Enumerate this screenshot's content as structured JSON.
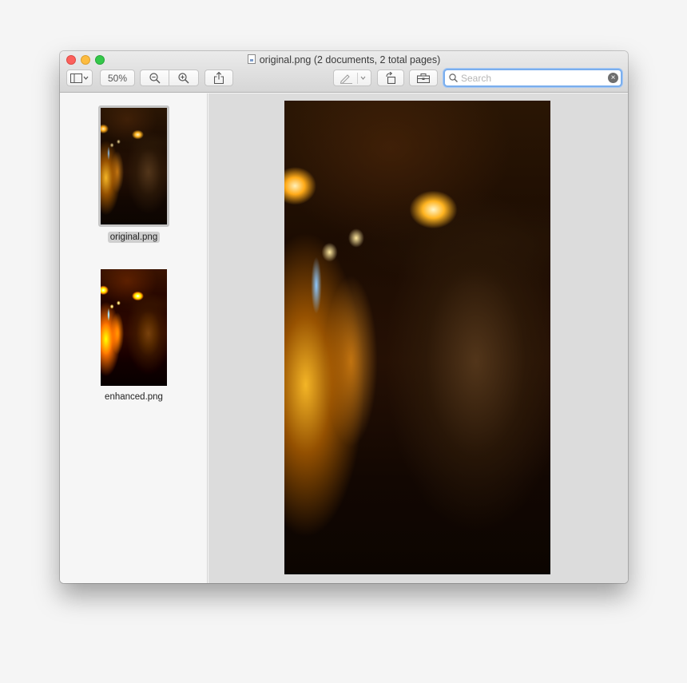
{
  "window": {
    "title": "original.png (2 documents, 2 total pages)"
  },
  "toolbar": {
    "sidebar_toggle_icon": "sidebar-icon",
    "zoom_level": "50%",
    "zoom_out_icon": "zoom-out-icon",
    "zoom_in_icon": "zoom-in-icon",
    "share_icon": "share-icon",
    "markup_icon": "pen-icon",
    "rotate_icon": "rotate-left-icon",
    "toolbox_icon": "toolbox-icon",
    "search": {
      "placeholder": "Search",
      "value": ""
    }
  },
  "sidebar": {
    "items": [
      {
        "label": "original.png",
        "selected": true
      },
      {
        "label": "enhanced.png",
        "selected": false
      }
    ]
  },
  "colors": {
    "search_focus": "#7aaeed",
    "close": "#fc605c",
    "minimize": "#fdbc40",
    "maximize": "#34c84a"
  }
}
